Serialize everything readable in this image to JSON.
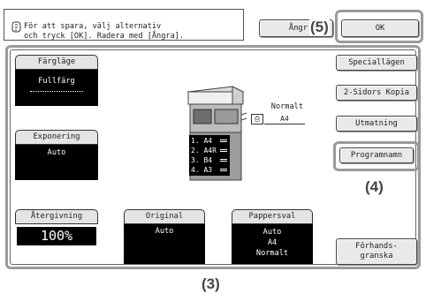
{
  "header": {
    "message_line1": "För att spara, välj alternativ",
    "message_line2": "och tryck [OK]. Radera med [Ångra].",
    "cancel_label": "Ångr",
    "ok_label": "OK"
  },
  "callouts": {
    "five": "(5)",
    "four": "(4)",
    "three": "(3)"
  },
  "color_mode": {
    "label": "Färgläge",
    "value": "Fullfärg"
  },
  "exposure": {
    "label": "Exponering",
    "value": "Auto"
  },
  "reproduction": {
    "label": "Återgivning",
    "value": "100%"
  },
  "original": {
    "label": "Original",
    "value": "Auto"
  },
  "paper": {
    "label": "Pappersval",
    "value1": "Auto",
    "value2": "A4",
    "value3": "Normalt"
  },
  "output_tray": {
    "type": "Normalt",
    "size": "A4"
  },
  "trays": [
    {
      "label": "1.  A4"
    },
    {
      "label": "2.  A4R"
    },
    {
      "label": "3.  B4"
    },
    {
      "label": "4.  A3"
    }
  ],
  "right_menu": {
    "special": "Speciallägen",
    "duplex": "2-Sidors Kopia",
    "output": "Utmatning",
    "program_name": "Programnamn",
    "preview_line1": "Förhands-",
    "preview_line2": "granska"
  }
}
